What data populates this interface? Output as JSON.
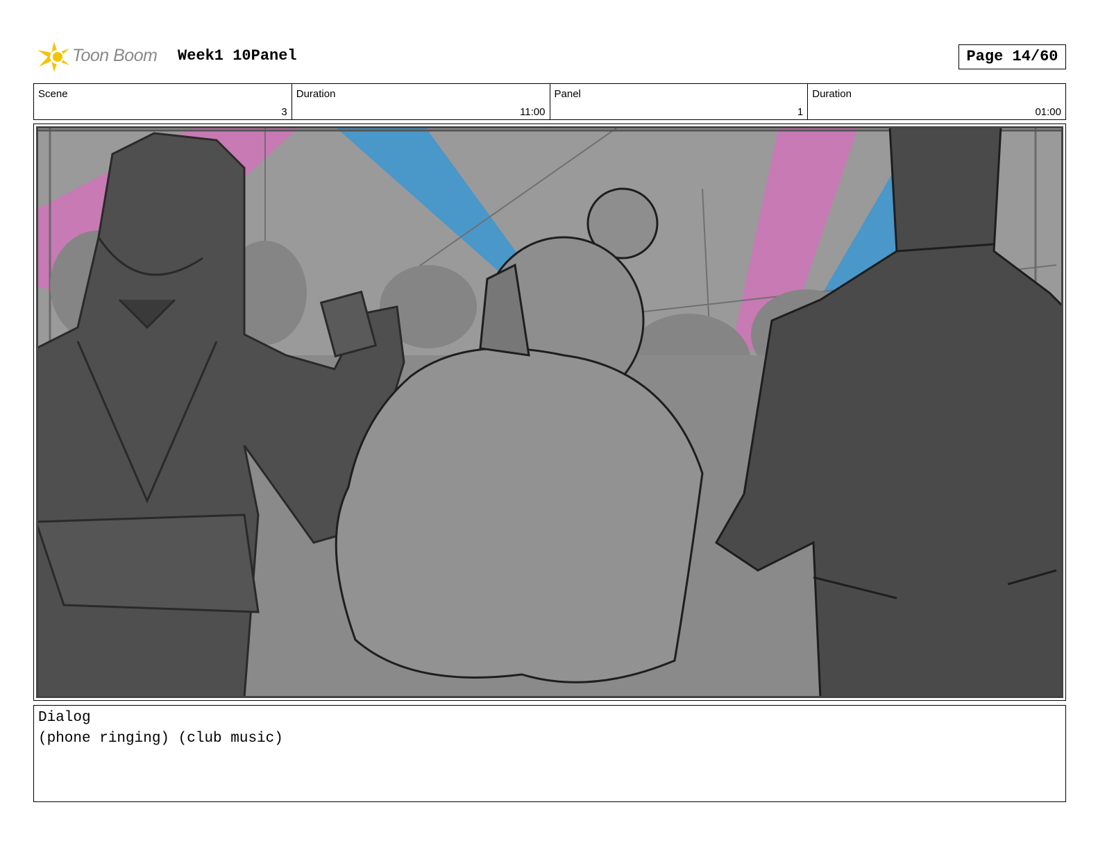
{
  "header": {
    "logo_text": "Toon Boom",
    "project_title": "Week1 10Panel",
    "page_label": "Page 14/60"
  },
  "info": {
    "scene_label": "Scene",
    "scene_value": "3",
    "duration_label": "Duration",
    "duration_value": "11:00",
    "panel_label": "Panel",
    "panel_value": "1",
    "panel_duration_label": "Duration",
    "panel_duration_value": "01:00"
  },
  "dialog": {
    "label": "Dialog",
    "text": "(phone ringing) (club music)"
  },
  "colors": {
    "accent_yellow": "#f5c400",
    "laser_pink": "#c77ab4",
    "laser_blue": "#4a97c9",
    "background_grey": "#9a9a9a"
  }
}
